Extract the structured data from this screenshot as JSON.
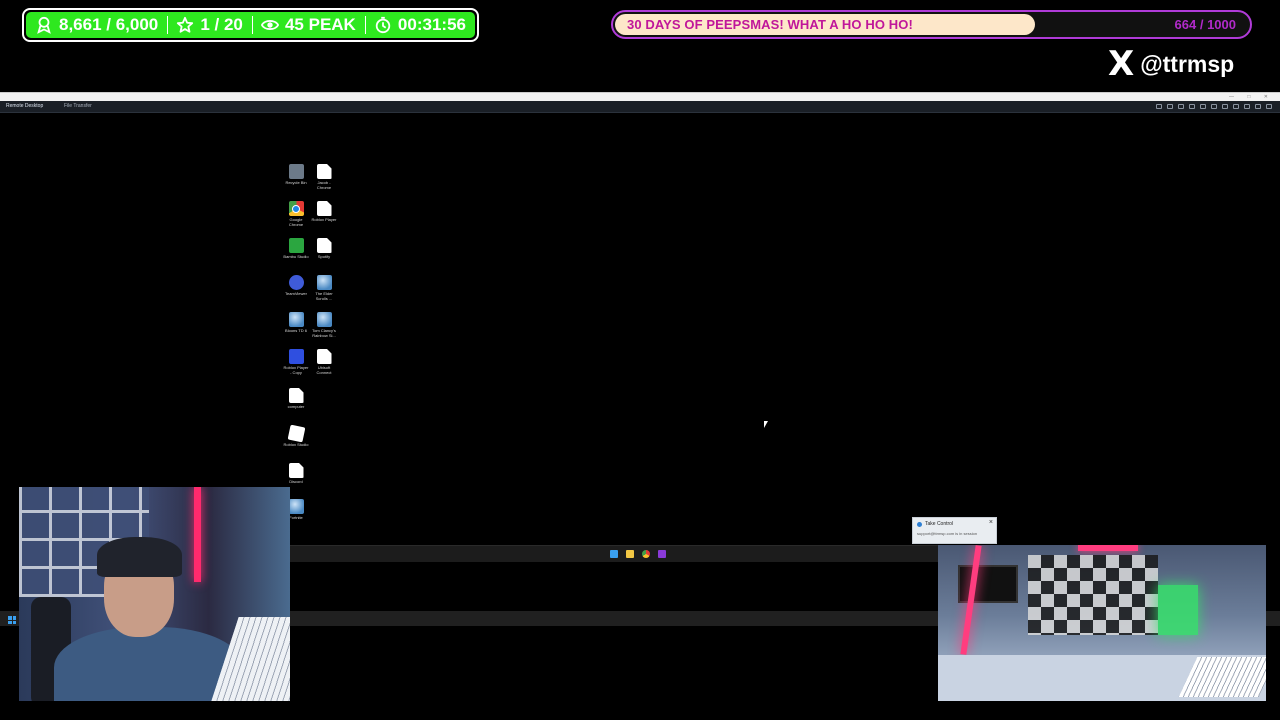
{
  "overlay": {
    "stats": {
      "followers": "8,661 / 6,000",
      "subs": "1 / 20",
      "viewers": "45 PEAK",
      "uptime": "00:31:56"
    },
    "goal": {
      "title": "30 DAYS OF PEEPSMAS! WHAT A HO HO HO!",
      "count": "664 / 1000",
      "progress": 0.664
    },
    "social": {
      "logo": "X",
      "handle": "@ttrmsp"
    },
    "colors": {
      "stats_green": "#2ee81f",
      "goal_border": "#b03bd8",
      "goal_fill": "#fde7c9",
      "goal_text": "#c0169a"
    }
  },
  "remote_window": {
    "tabs": [
      "Remote Desktop",
      "File Transfer"
    ]
  },
  "desktop": {
    "icons": [
      {
        "label": "Recycle Bin",
        "icon": "recycle-bin-icon"
      },
      {
        "label": "Jacob - Chrome",
        "icon": "file-icon"
      },
      {
        "label": "Google Chrome",
        "icon": "chrome-icon"
      },
      {
        "label": "Roblox Player",
        "icon": "file-icon"
      },
      {
        "label": "Bambu Studio",
        "icon": "bambu-icon"
      },
      {
        "label": "Spotify",
        "icon": "file-icon"
      },
      {
        "label": "TeamViewer",
        "icon": "teamviewer-icon"
      },
      {
        "label": "The Elder Scrolls ...",
        "icon": "globe-icon"
      },
      {
        "label": "Bloons TD 6",
        "icon": "globe-icon"
      },
      {
        "label": "Tom Clancy's Rainbow Si...",
        "icon": "globe-icon"
      },
      {
        "label": "Roblox Player - Copy",
        "icon": "roblox-player-icon"
      },
      {
        "label": "Ubisoft Connect",
        "icon": "file-icon"
      },
      {
        "label": "computer",
        "icon": "file-icon"
      },
      {
        "label": "Roblox Studio",
        "icon": "roblox-studio-icon"
      },
      {
        "label": "Discord",
        "icon": "file-icon"
      },
      {
        "label": "Fortnite",
        "icon": "globe-icon"
      }
    ]
  },
  "toast": {
    "title": "Take Control",
    "body": "support@ttrmsp.com is in session",
    "close": "×"
  }
}
